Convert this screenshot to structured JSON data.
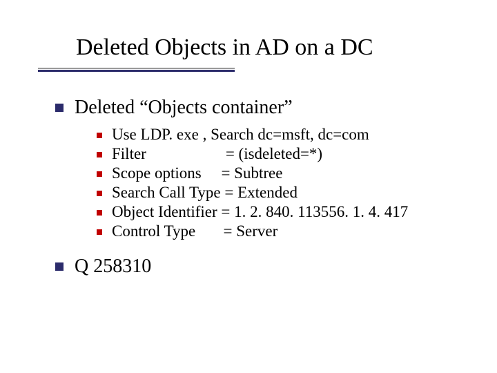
{
  "title": "Deleted Objects in AD on a DC",
  "section1": {
    "heading": "Deleted “Objects container”",
    "items": [
      "Use LDP. exe , Search dc=msft, dc=com",
      "Filter                    = (isdeleted=*)",
      "Scope options     = Subtree",
      "Search Call Type = Extended",
      "Object Identifier = 1. 2. 840. 113556. 1. 4. 417",
      "Control Type       = Server"
    ]
  },
  "section2": {
    "heading": "Q 258310"
  }
}
